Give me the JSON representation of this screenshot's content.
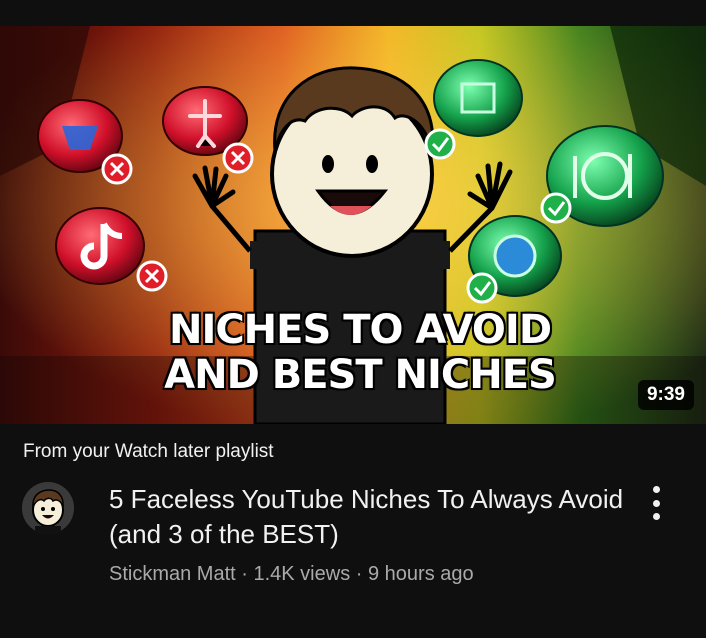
{
  "video": {
    "thumbnail_text": "NICHES TO AVOID AND BEST NICHES",
    "duration": "9:39",
    "source_label": "From your Watch later playlist",
    "title": "5 Faceless YouTube Niches To Always Avoid (and 3 of the BEST)",
    "channel": "Stickman Matt",
    "views": "1.4K views",
    "age": "9 hours ago",
    "separator": " · "
  },
  "icons": {
    "avatar": "stickman-avatar-icon",
    "more": "more-vertical-icon",
    "avoid_badge": "red-x-icon",
    "best_badge": "green-check-icon"
  },
  "colors": {
    "background": "#0f0f0f",
    "text_primary": "#f1f1f1",
    "text_secondary": "#aaaaaa",
    "avoid": "#e01e2a",
    "best": "#1fb04a"
  }
}
